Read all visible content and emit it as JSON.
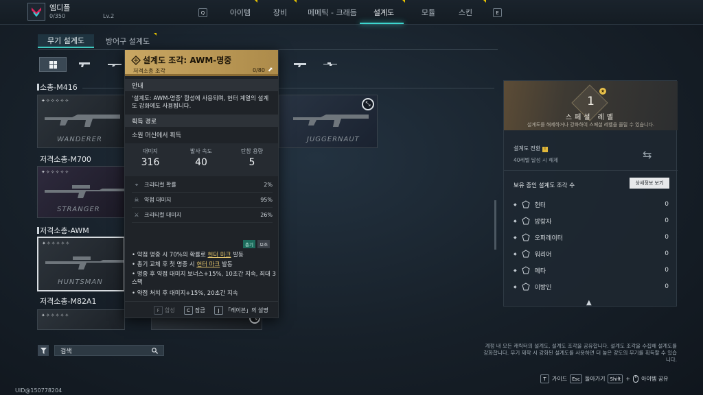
{
  "player": {
    "name": "엠디플",
    "exp": "0/350",
    "level": "Lv.2",
    "uid": "UID@150778204"
  },
  "nav": {
    "key_left": "Q",
    "key_right": "E",
    "tabs": [
      {
        "label": "아이템"
      },
      {
        "label": "장비"
      },
      {
        "label": "메메틱 - 크래듬"
      },
      {
        "label": "설계도"
      },
      {
        "label": "모듈"
      },
      {
        "label": "스킨"
      }
    ],
    "active_tab": "설계도"
  },
  "subtabs": {
    "weapon": "무기 설계도",
    "armor": "방어구 설계도"
  },
  "weapon_groups": [
    {
      "label": "소총-M416",
      "cards": [
        "WANDERER",
        "JUGGERNAUT"
      ]
    },
    {
      "label": "저격소총-M700",
      "cards": [
        "STRANGER"
      ]
    },
    {
      "label": "저격소총-AWM",
      "cards": [
        "HUNTSMAN"
      ]
    },
    {
      "label": "저격소총-M82A1",
      "cards": []
    }
  ],
  "search": {
    "placeholder": "검색"
  },
  "tooltip": {
    "title": "설계도 조각: AWM-명중",
    "subtitle": "저격소총   조각",
    "count": "0/80",
    "section_info": "안내",
    "info_text": "'설계도: AWM-명중' 합성에 사용되며, 헌터 계열의 설계도 강화에도 사용됩니다.",
    "section_acquire": "획득 경로",
    "acquire_text": "소원 머신에서 획득",
    "stats": [
      {
        "label": "대미지",
        "value": "316"
      },
      {
        "label": "발사 속도",
        "value": "40"
      },
      {
        "label": "탄창 용량",
        "value": "5"
      }
    ],
    "sub_stats": [
      {
        "label": "크리티컬 확률",
        "value": "2%"
      },
      {
        "label": "약점 대미지",
        "value": "95%"
      },
      {
        "label": "크리티컬 대미지",
        "value": "26%"
      }
    ],
    "badges": [
      "총기",
      "보조"
    ],
    "bullets": {
      "b1_pre": "약점 명중 시 70%의 확률로 ",
      "b1_hl": "헌터 마크",
      "b1_post": " 발동",
      "b2_pre": "총기 교체 후 첫 명중 시 ",
      "b2_hl": "헌터 마크",
      "b2_post": " 발동",
      "b3": "명중 후 약점 대미지 보너스+15%, 10초간 지속, 최대 3스택",
      "b4": "약점 처치 후 대미지+15%, 20초간 지속"
    },
    "keys": [
      {
        "key": "F",
        "label": "합성"
      },
      {
        "key": "C",
        "label": "잠금"
      },
      {
        "key": "J",
        "label": "「레이븐」의 설명"
      }
    ]
  },
  "right_panel": {
    "level_num": "1",
    "level_label": "스페셜 레벨",
    "level_desc": "설계도를 해제하거나 강화하여 스페셜 레벨을 올릴 수 있습니다.",
    "convert_label": "설계도 전환",
    "convert_sub": "40레벨 달성 시 해제",
    "own_label": "보유 중인 설계도 조각 수",
    "detail_btn": "상세정보 보기",
    "classes": [
      {
        "name": "헌터",
        "count": "0"
      },
      {
        "name": "방랑자",
        "count": "0"
      },
      {
        "name": "오퍼레이터",
        "count": "0"
      },
      {
        "name": "워리어",
        "count": "0"
      },
      {
        "name": "메타",
        "count": "0"
      },
      {
        "name": "이방인",
        "count": "0"
      }
    ]
  },
  "info_text": "계정 내 모든 캐릭터의 설계도, 설계도 조각을 공유합니다. 설계도 조각을 수집해 설계도를 강화합니다. 무기 제작 시 강화된 설계도를 사용하면 더 높은 강도의 무기를 획득할 수 있습니다.",
  "bottom_keys": [
    {
      "key": "T",
      "label": "가이드"
    },
    {
      "key": "Esc",
      "label": "돌아가기"
    },
    {
      "key": "Shift",
      "label": "+"
    },
    {
      "key": "",
      "label": "아이템 공유"
    }
  ],
  "colors": {
    "accent": "#3dd6cf",
    "tooltip_header": "#c9a763",
    "flag": "#e6c200"
  }
}
